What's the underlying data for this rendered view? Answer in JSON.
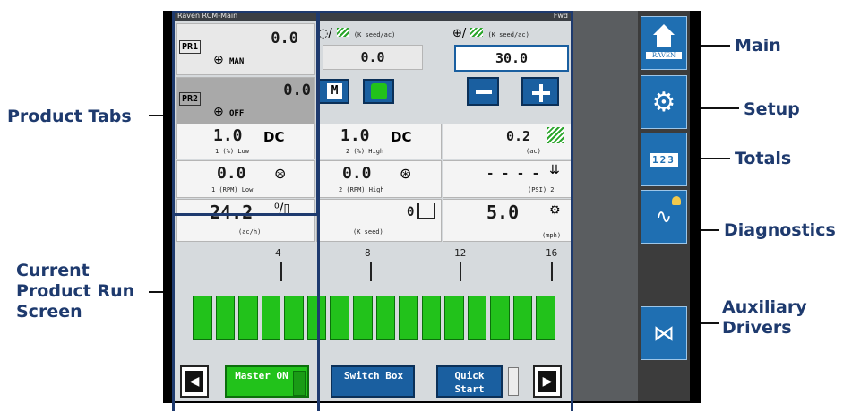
{
  "callouts": {
    "product_tabs": "Product Tabs",
    "current_run_line1": "Current",
    "current_run_line2": "Product Run",
    "current_run_line3": "Screen",
    "main": "Main",
    "setup": "Setup",
    "totals": "Totals",
    "diagnostics": "Diagnostics",
    "auxiliary_line1": "Auxiliary",
    "auxiliary_line2": "Drivers"
  },
  "screen": {
    "title": "Raven RCM-Main",
    "title_right": "Fwd",
    "product_tabs": [
      {
        "label": "PR1",
        "value": "0.0",
        "mode": "MAN"
      },
      {
        "label": "PR2",
        "value": "0.0",
        "mode": "OFF"
      }
    ],
    "rate_headers": {
      "actual_unit": "(K seed/ac)",
      "target_unit": "(K seed/ac)"
    },
    "actual_rate": "0.0",
    "target_rate": "30.0",
    "duty_cycle_1": {
      "value": "1.0",
      "unit": "DC",
      "caption": "1 (%) Low"
    },
    "duty_cycle_2": {
      "value": "1.0",
      "unit": "DC",
      "caption": "2 (%) High"
    },
    "area": {
      "value": "0.2",
      "caption": "(ac)"
    },
    "rpm_1": {
      "value": "0.0",
      "caption": "1 (RPM) Low"
    },
    "rpm_2": {
      "value": "0.0",
      "caption": "2 (RPM) High"
    },
    "pressure": {
      "value": "- - - -",
      "caption": "(PSI) 2"
    },
    "area_rate": {
      "value": "24.2",
      "caption": "(ac/h)"
    },
    "seed_count": {
      "value": "0",
      "caption": "(K seed)"
    },
    "speed": {
      "value": "5.0",
      "caption": "(mph)"
    },
    "row_ticks": [
      "4",
      "8",
      "12",
      "16"
    ],
    "section_count": 16,
    "bottom_buttons": {
      "master": "Master ON",
      "switch_box": "Switch Box",
      "quick_start": "Quick Start"
    }
  },
  "sidebar": {
    "brand": "RAVEN",
    "totals_label": "123"
  },
  "colors": {
    "callout_text": "#1e3a6e",
    "section_green": "#22c21b",
    "sidebar_blue": "#1f6fb2"
  }
}
